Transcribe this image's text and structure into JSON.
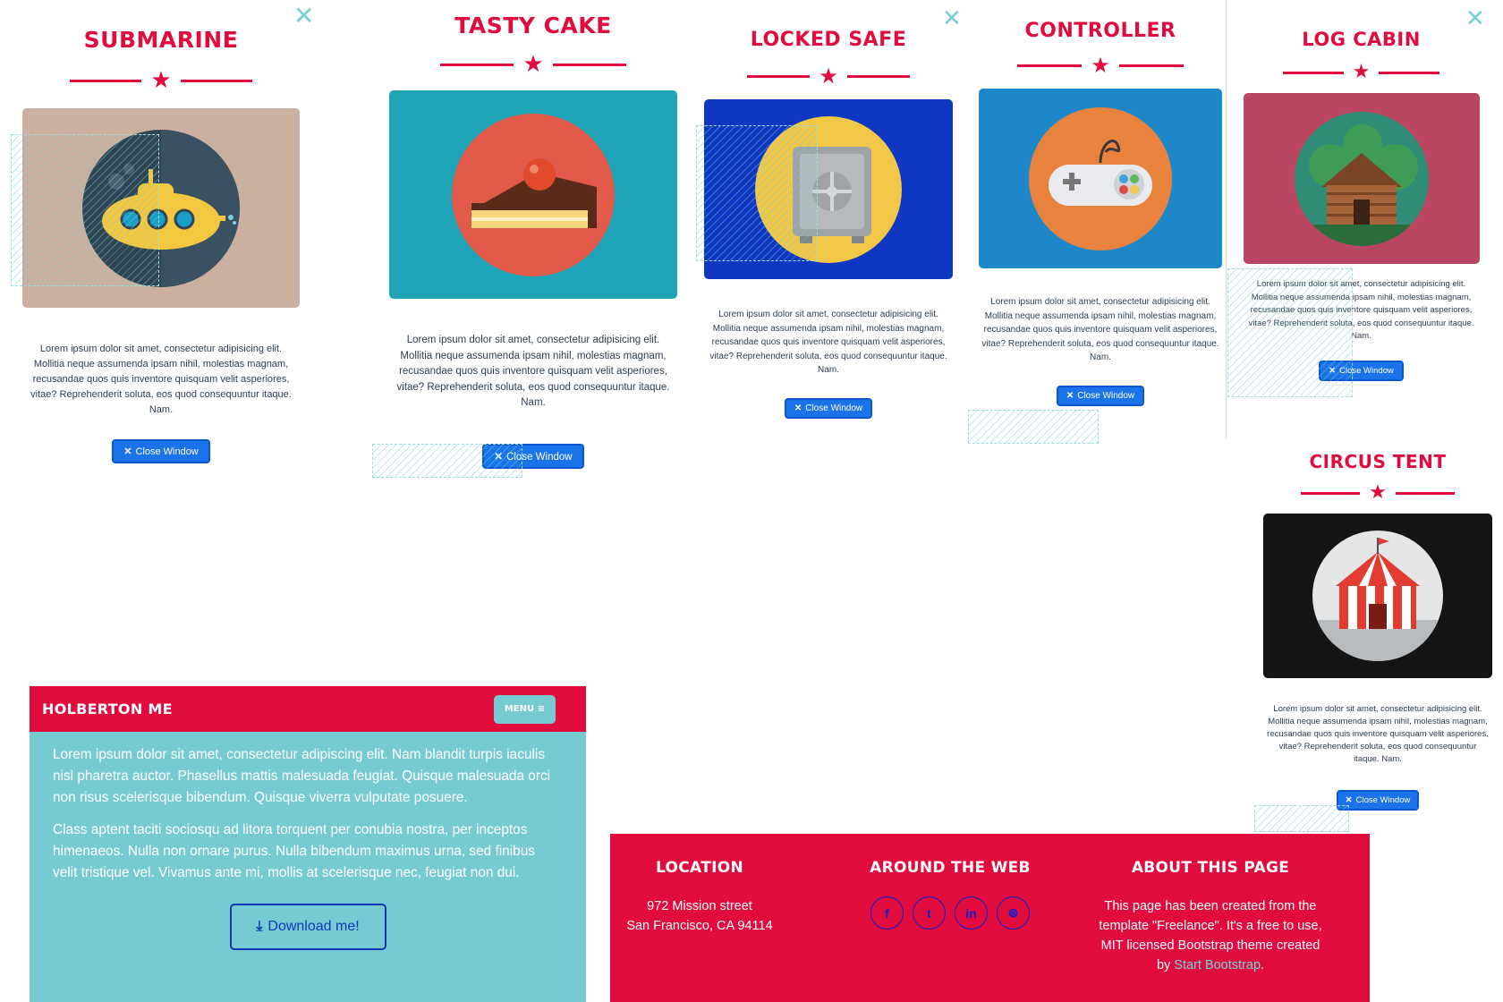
{
  "colors": {
    "accent": "#e20b3d",
    "teal": "#76cbd2",
    "button_blue": "#1a73e8",
    "close_x": "#74cfd6"
  },
  "lorem": "Lorem ipsum dolor sit amet, consectetur adipisicing elit. Mollitia neque assumenda ipsam nihil, molestias magnam, recusandae quos quis inventore quisquam velit asperiores, vitae? Reprehenderit soluta, eos quod consequuntur itaque. Nam.",
  "close_label": "Close Window",
  "close_x": "✕",
  "star": "★",
  "modals": [
    {
      "title": "SUBMARINE",
      "image": "submarine-icon",
      "bg": "#cbb09f"
    },
    {
      "title": "TASTY CAKE",
      "image": "cake-icon",
      "bg": "#1fa3b6"
    },
    {
      "title": "LOCKED SAFE",
      "image": "safe-icon",
      "bg": "#1037c2"
    },
    {
      "title": "CONTROLLER",
      "image": "game-controller-icon",
      "bg": "#1e87c9"
    },
    {
      "title": "LOG CABIN",
      "image": "log-cabin-icon",
      "bg": "#b94561"
    },
    {
      "title": "CIRCUS TENT",
      "image": "circus-tent-icon",
      "bg": "#141414"
    }
  ],
  "phone": {
    "brand": "HOLBERTON ME",
    "menu": "MENU ≡",
    "para1": "Lorem ipsum dolor sit amet, consectetur adipiscing elit. Nam blandit turpis iaculis nisl pharetra auctor. Phasellus mattis malesuada feugiat. Quisque malesuada orci non risus scelerisque bibendum. Quisque viverra vulputate posuere.",
    "para2": "Class aptent taciti sociosqu ad litora torquent per conubia nostra, per inceptos himenaeos. Nulla non ornare purus. Nulla bibendum maximus urna, sed finibus velit tristique vel. Vivamus ante mi, mollis at scelerisque nec, feugiat non dui.",
    "download": "Download me!"
  },
  "footer": {
    "location_title": "LOCATION",
    "address_line1": "972 Mission street",
    "address_line2": "San Francisco, CA 94114",
    "web_title": "AROUND THE WEB",
    "social": [
      "f",
      "t",
      "in",
      "⊛"
    ],
    "about_title": "ABOUT THIS PAGE",
    "about_text": "This page has been created from the template \"Freelance\". It's a free to use, MIT licensed Bootstrap theme created by",
    "about_link": "Start Bootstrap",
    "about_end": "."
  }
}
